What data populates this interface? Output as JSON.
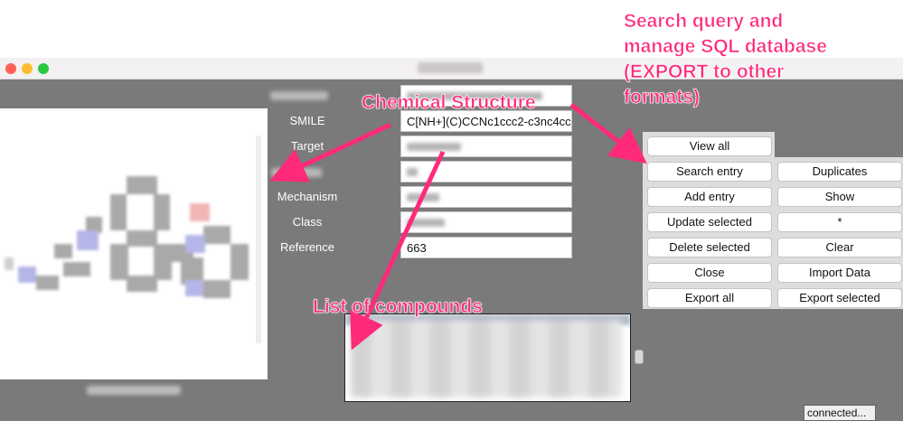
{
  "form": {
    "labels": {
      "smile": "SMILE",
      "target": "Target",
      "mechanism": "Mechanism",
      "class": "Class",
      "reference": "Reference"
    },
    "values": {
      "smile": "C[NH+](C)CCNc1ccc2-c3nc4cc",
      "reference": "663"
    }
  },
  "buttons": {
    "view_all": "View all",
    "search_entry": "Search entry",
    "duplicates": "Duplicates",
    "add_entry": "Add entry",
    "show": "Show",
    "update_selected": "Update selected",
    "star": "*",
    "delete_selected": "Delete selected",
    "clear": "Clear",
    "close": "Close",
    "import_data": "Import Data",
    "export_all": "Export all",
    "export_selected": "Export selected"
  },
  "status": "connected...",
  "annotations": {
    "search_line1": "Search query and",
    "search_line2": "manage SQL database",
    "search_line3": "(EXPORT to other",
    "search_line4": "formats)",
    "chemical_structure": "Chemical Structure",
    "list_of_compounds": "List of compounds"
  },
  "colors": {
    "annotation": "#ff2a7a",
    "app_background": "#7a7a7a",
    "button_panel": "#dddddd"
  }
}
